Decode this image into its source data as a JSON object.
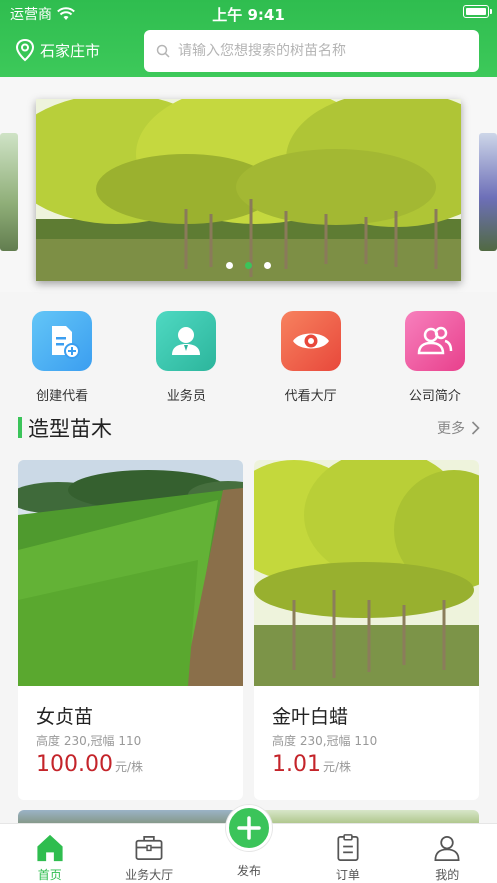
{
  "status_bar": {
    "carrier": "运营商",
    "time": "上午 9:41"
  },
  "header": {
    "city": "石家庄市",
    "search_placeholder": "请输入您想搜索的树苗名称"
  },
  "banner": {
    "dots": 3,
    "active_dot": 1
  },
  "quick_menu": [
    {
      "label": "创建代看",
      "icon": "document-add-icon",
      "color": "#4fb6f2"
    },
    {
      "label": "业务员",
      "icon": "person-icon",
      "color": "#3fcbb2"
    },
    {
      "label": "代看大厅",
      "icon": "eye-icon",
      "color": "#f2684a"
    },
    {
      "label": "公司简介",
      "icon": "group-icon",
      "color": "#f25ea5"
    }
  ],
  "section": {
    "title": "造型苗木",
    "more_label": "更多"
  },
  "products": [
    {
      "name": "女贞苗",
      "spec": "高度 230,冠幅 110",
      "price": "100.00",
      "unit": "元/株"
    },
    {
      "name": "金叶白蜡",
      "spec": "高度 230,冠幅 110",
      "price": "1.01",
      "unit": "元/株"
    }
  ],
  "tabbar": {
    "items": [
      {
        "label": "首页",
        "icon": "home-icon",
        "active": true
      },
      {
        "label": "业务大厅",
        "icon": "briefcase-icon",
        "active": false
      },
      {
        "label": "发布",
        "icon": "plus-icon",
        "active": false
      },
      {
        "label": "订单",
        "icon": "clipboard-icon",
        "active": false
      },
      {
        "label": "我的",
        "icon": "user-icon",
        "active": false
      }
    ]
  },
  "colors": {
    "brand_green": "#3bc45a",
    "price_red": "#c4242a"
  }
}
